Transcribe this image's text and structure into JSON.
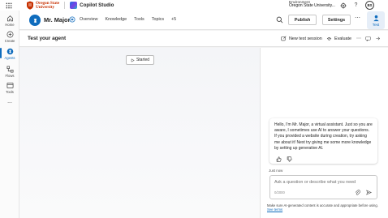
{
  "topbar": {
    "org_line1": "Oregon State",
    "org_line2": "University",
    "app_title": "Copilot Studio",
    "env_label": "Environment",
    "env_name": "Oregon State University...",
    "avatar_initials": "BS"
  },
  "rail": {
    "items": [
      {
        "label": "Home",
        "icon": "home-icon"
      },
      {
        "label": "Create",
        "icon": "plus-circle-icon"
      },
      {
        "label": "Agents",
        "icon": "agents-icon"
      },
      {
        "label": "Flows",
        "icon": "flows-icon"
      },
      {
        "label": "Tools",
        "icon": "tools-icon"
      },
      {
        "label": "...",
        "icon": "more-icon"
      }
    ]
  },
  "agent": {
    "name": "Mr. Major",
    "tabs": [
      "Overview",
      "Knowledge",
      "Tools",
      "Topics",
      "+5"
    ],
    "publish_label": "Publish",
    "settings_label": "Settings",
    "more_label": "⋯",
    "test_label": "Test"
  },
  "test_panel": {
    "title": "Test your agent",
    "new_session_label": "New test session",
    "evaluate_label": "Evaluate",
    "more_label": "⋯",
    "started_label": "Started"
  },
  "chat": {
    "message": "Hello, I'm Mr. Major, a virtual assistant. Just so you are aware, I sometimes use AI to answer your questions. If you provided a website during creation, try asking me about it! Next try giving me some more knowledge by setting up generative AI.",
    "timestamp": "Just now",
    "input_placeholder": "Ask a question or describe what you need",
    "char_count": "0/2000",
    "disclaimer_text": "Make sure AI-generated content is accurate and appropriate before using.",
    "disclaimer_link": "See terms"
  },
  "colors": {
    "accent": "#0f6cbd",
    "brand_osu": "#c73000"
  }
}
